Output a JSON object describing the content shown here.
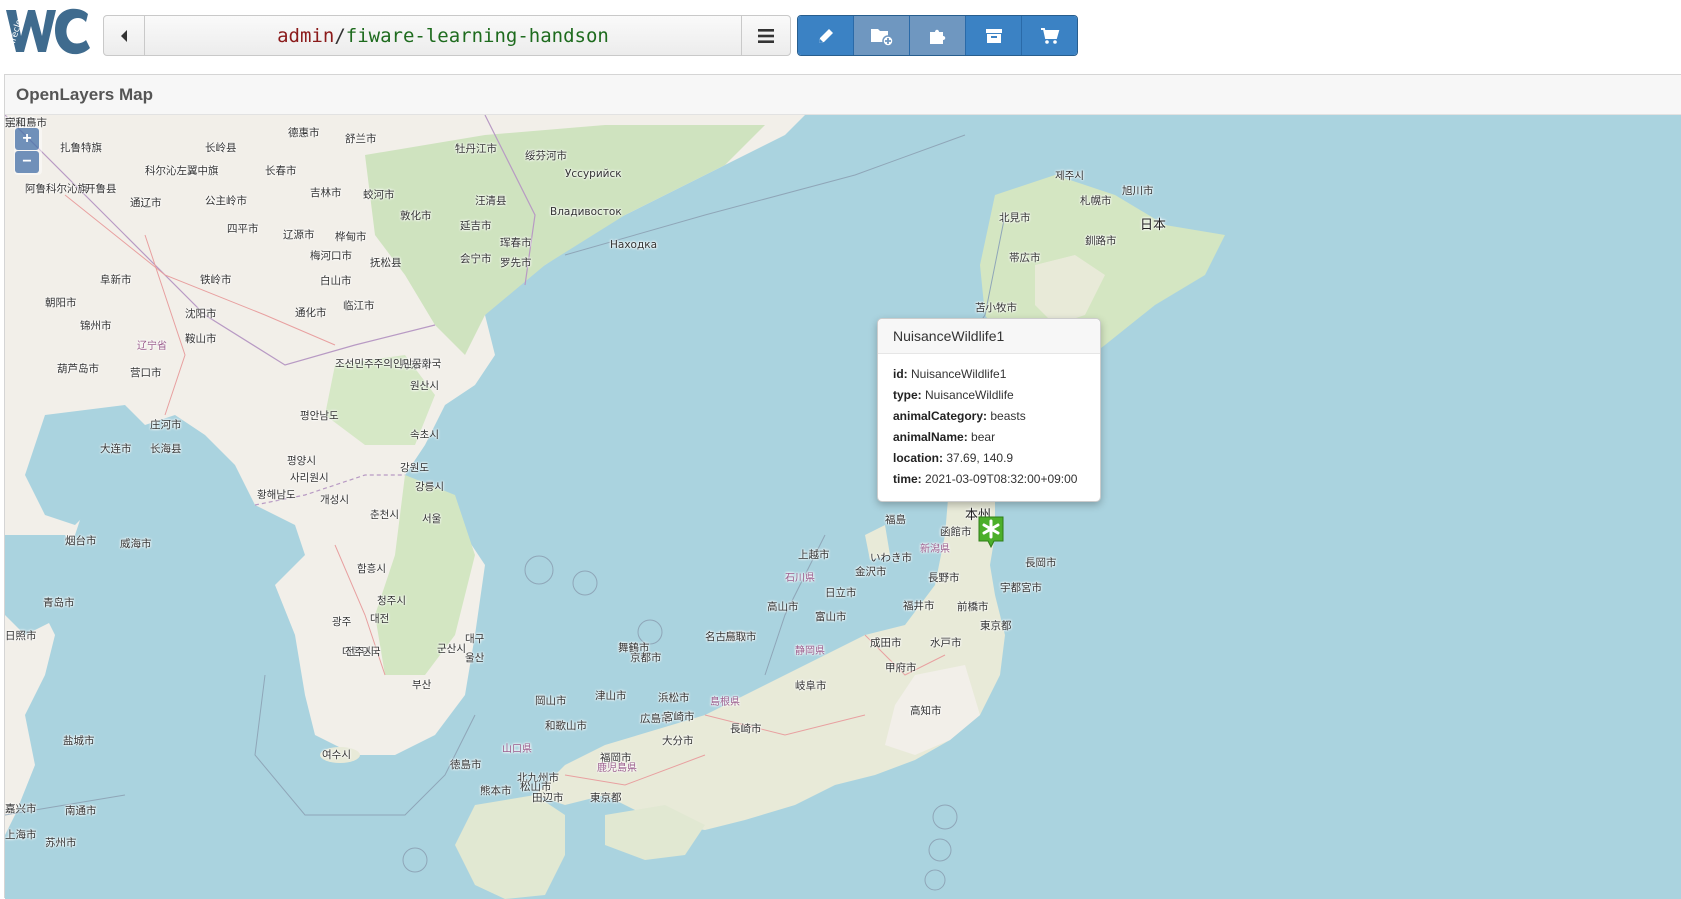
{
  "header": {
    "logo_text": "Wirecloud",
    "workspace_owner": "admin",
    "workspace_sep": "/",
    "workspace_name": "fiware-learning-handson",
    "buttons": [
      {
        "name": "edit",
        "icon": "pencil-icon"
      },
      {
        "name": "add-widget",
        "icon": "add-widget-icon"
      },
      {
        "name": "components",
        "icon": "puzzle-icon"
      },
      {
        "name": "my-resources",
        "icon": "archive-icon"
      },
      {
        "name": "marketplace",
        "icon": "cart-icon"
      }
    ]
  },
  "widget": {
    "title": "OpenLayers Map",
    "zoom_in": "+",
    "zoom_out": "−"
  },
  "popup": {
    "title": "NuisanceWildlife1",
    "rows": [
      {
        "key": "id:",
        "value": "NuisanceWildlife1"
      },
      {
        "key": "type:",
        "value": "NuisanceWildlife"
      },
      {
        "key": "animalCategory:",
        "value": "beasts"
      },
      {
        "key": "animalName:",
        "value": "bear"
      },
      {
        "key": "location:",
        "value": "37.69, 140.9"
      },
      {
        "key": "time:",
        "value": "2021-03-09T08:32:00+09:00"
      }
    ]
  },
  "map_labels": [
    "扎鲁特旗",
    "长岭县",
    "德惠市",
    "舒兰市",
    "牡丹江市",
    "绥芬河市",
    "Уссурийск",
    "Владивосток",
    "Находка",
    "阿鲁科尔沁旗",
    "开鲁县",
    "科尔沁左翼中旗",
    "长春市",
    "吉林市",
    "蛟河市",
    "敦化市",
    "延吉市",
    "珲春市",
    "通辽市",
    "公主岭市",
    "四平市",
    "辽源市",
    "桦甸市",
    "梅河口市",
    "白山市",
    "汪清县",
    "会宁市",
    "罗先市",
    "阜新市",
    "铁岭市",
    "沈阳市",
    "通化市",
    "抚松县",
    "临江市",
    "朝阳市",
    "锦州市",
    "鞍山市",
    "辽宁省",
    "葫芦岛市",
    "营口市",
    "丹东市",
    "大连市",
    "长海县",
    "庄河市",
    "烟台市",
    "威海市",
    "青岛市",
    "日照市",
    "盐城市",
    "南通市",
    "上海市",
    "苏州市",
    "嘉兴市",
    "조선민주주의인민공화국",
    "평양시",
    "황해남도",
    "평안남도",
    "사리원시",
    "개성시",
    "강원도",
    "춘천시",
    "서울",
    "강릉시",
    "속초시",
    "원산시",
    "함흥시",
    "청주시",
    "대전",
    "대한민국",
    "광주",
    "전주시",
    "군산시",
    "대구",
    "울산",
    "부산",
    "여수시",
    "제주시",
    "旭川市",
    "北見市",
    "札幌市",
    "日本",
    "釧路市",
    "帯広市",
    "苫小牧市",
    "函館市",
    "本州",
    "福島",
    "新潟県",
    "長岡市",
    "いわき市",
    "上越市",
    "石川県",
    "金沢市",
    "長野市",
    "宇都宮市",
    "日立市",
    "富山市",
    "高山市",
    "福井市",
    "前橋市",
    "水戸市",
    "東京都",
    "成田市",
    "甲府市",
    "静岡県",
    "名古屋市",
    "鳥取市",
    "岐阜市",
    "舞鶴市",
    "京都市",
    "浜松市",
    "島根県",
    "津山市",
    "岡山市",
    "和歌山市",
    "広島市",
    "山口県",
    "北九州市",
    "松山市",
    "福岡市",
    "熊本市",
    "大分市",
    "宮崎市",
    "長崎市",
    "高知市",
    "徳島市",
    "田辺市",
    "東京都",
    "鹿児島県",
    "八代市",
    "延岡市",
    "宇和島市"
  ]
}
